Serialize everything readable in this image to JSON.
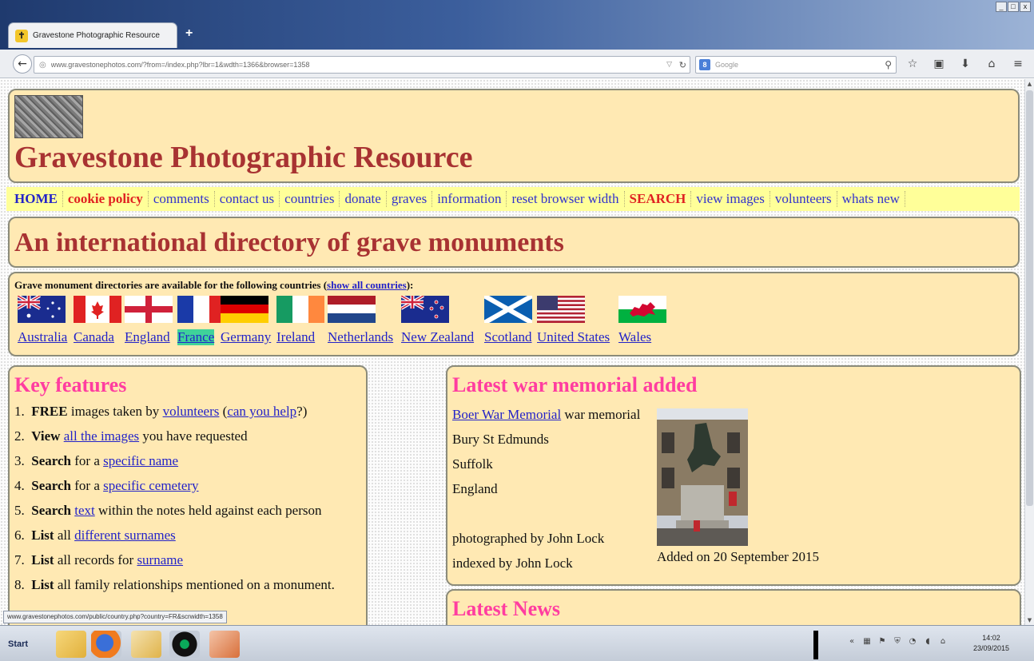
{
  "window": {
    "tab_title": "Gravestone Photographic Resource",
    "new_tab_symbol": "+",
    "controls": [
      "_",
      "□",
      "x"
    ]
  },
  "navbar": {
    "url": "www.gravestonephotos.com/?from=/index.php?lbr=1&wdth=1366&browser=1358",
    "search_placeholder": "Google"
  },
  "site": {
    "title": "Gravestone Photographic Resource",
    "menu": [
      {
        "label": "HOME",
        "style": "home"
      },
      {
        "label": "cookie policy",
        "style": "red"
      },
      {
        "label": "comments",
        "style": "normal"
      },
      {
        "label": "contact us",
        "style": "normal"
      },
      {
        "label": "countries",
        "style": "normal"
      },
      {
        "label": "donate",
        "style": "normal"
      },
      {
        "label": "graves",
        "style": "normal"
      },
      {
        "label": "information",
        "style": "normal"
      },
      {
        "label": "reset browser width",
        "style": "normal"
      },
      {
        "label": "SEARCH",
        "style": "search"
      },
      {
        "label": "view images",
        "style": "normal"
      },
      {
        "label": "volunteers",
        "style": "normal"
      },
      {
        "label": "whats new",
        "style": "normal"
      }
    ],
    "headline": "An international directory of grave monuments"
  },
  "directory": {
    "intro_before": "Grave monument directories are available for the following countries (",
    "show_all_link": "show all countries",
    "intro_after": "):",
    "countries": [
      "Australia",
      "Canada",
      "England",
      "France",
      "Germany",
      "Ireland",
      "Netherlands",
      "New Zealand",
      "Scotland",
      "United States",
      "Wales"
    ],
    "active_country": "France"
  },
  "features": {
    "heading": "Key features",
    "items": [
      {
        "n": "1.",
        "bold": "FREE",
        "pre": " images taken by ",
        "link": "volunteers",
        "post": " (",
        "link2": "can you help",
        "post2": "?)"
      },
      {
        "n": "2.",
        "bold": "View",
        "pre": " ",
        "link": "all the images",
        "post": " you have requested"
      },
      {
        "n": "3.",
        "bold": "Search",
        "pre": " for a ",
        "link": "specific name",
        "post": ""
      },
      {
        "n": "4.",
        "bold": "Search",
        "pre": " for a ",
        "link": "specific cemetery",
        "post": ""
      },
      {
        "n": "5.",
        "bold": "Search",
        "pre": " ",
        "link": "text",
        "post": " within the notes held against each person"
      },
      {
        "n": "6.",
        "bold": "List",
        "pre": " all ",
        "link": "different surnames",
        "post": ""
      },
      {
        "n": "7.",
        "bold": "List",
        "pre": " all records for ",
        "link": "surname",
        "post": ""
      },
      {
        "n": "8.",
        "bold": "List",
        "pre": " all family relationships mentioned on a monument.",
        "link": "",
        "post": ""
      }
    ]
  },
  "memorial": {
    "heading": "Latest war memorial added",
    "name_link": "Boer War Memorial",
    "type": " war memorial",
    "town": "Bury St Edmunds",
    "county": "Suffolk",
    "country": "England",
    "photographer": "photographed by John Lock",
    "indexer": "indexed by John Lock",
    "added": "Added on 20 September 2015"
  },
  "news": {
    "heading": "Latest News"
  },
  "status_tip": "www.gravestonephotos.com/public/country.php?country=FR&scrwidth=1358",
  "taskbar": {
    "start_label": "Start",
    "time": "14:02",
    "date": "23/09/2015"
  },
  "colors": {
    "title_red": "#a83232",
    "link_blue": "#2323c8",
    "heading_pink": "#ff3da0",
    "panel_bg": "#ffe9b3",
    "menu_bg": "#ffff99"
  }
}
